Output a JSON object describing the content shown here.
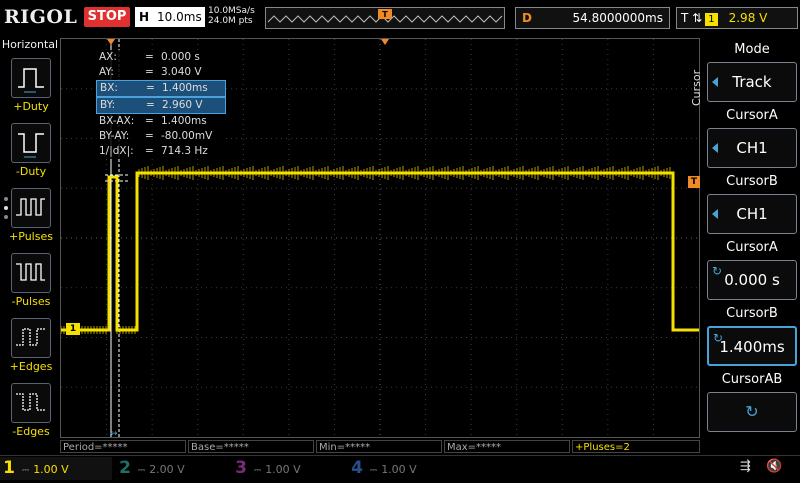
{
  "topbar": {
    "brand": "RIGOL",
    "run_state": "STOP",
    "timebase_label": "H",
    "timebase_value": "10.0ms",
    "sample_rate": "10.0MSa/s",
    "memory_depth": "24.0M pts",
    "delay_label": "D",
    "delay_value": "54.8000000ms",
    "trigger_type": "T",
    "trigger_source": "1",
    "trigger_level": "2.98 V"
  },
  "left_panel": {
    "title": "Horizontal",
    "items": [
      {
        "label": "+Duty",
        "icon": "positive-duty-icon"
      },
      {
        "label": "-Duty",
        "icon": "negative-duty-icon"
      },
      {
        "label": "+Pulses",
        "icon": "positive-pulses-icon"
      },
      {
        "label": "-Pulses",
        "icon": "negative-pulses-icon"
      },
      {
        "label": "+Edges",
        "icon": "rising-edges-icon"
      },
      {
        "label": "-Edges",
        "icon": "falling-edges-icon"
      }
    ]
  },
  "cursor_readout": [
    {
      "key": "AX:",
      "value": "0.000 s",
      "selected": false
    },
    {
      "key": "AY:",
      "value": "3.040 V",
      "selected": false
    },
    {
      "key": "BX:",
      "value": "1.400ms",
      "selected": true
    },
    {
      "key": "BY:",
      "value": "2.960 V",
      "selected": true
    },
    {
      "key": "BX-AX:",
      "value": "1.400ms",
      "selected": false
    },
    {
      "key": "BY-AY:",
      "value": "-80.00mV",
      "selected": false
    },
    {
      "key": "1/|dX|:",
      "value": "714.3 Hz",
      "selected": false
    }
  ],
  "measure_bar": {
    "period": "Period=*****",
    "base": "Base=*****",
    "min": "Min=*****",
    "max": "Max=*****",
    "pulses": "+Pluses=2"
  },
  "channels": [
    {
      "num": "1",
      "scale": "1.00 V",
      "color": "#f5e000",
      "active": true
    },
    {
      "num": "2",
      "scale": "2.00 V",
      "color": "#22c7b8",
      "active": false
    },
    {
      "num": "3",
      "scale": "1.00 V",
      "color": "#d040d0",
      "active": false
    },
    {
      "num": "4",
      "scale": "1.00 V",
      "color": "#3a7ee0",
      "active": false
    }
  ],
  "right_menu": {
    "side_label": "Cursor",
    "mode_label": "Mode",
    "mode_value": "Track",
    "cursorA_source_label": "CursorA",
    "cursorA_source_value": "CH1",
    "cursorB_source_label": "CursorB",
    "cursorB_source_value": "CH1",
    "cursorA_pos_label": "CursorA",
    "cursorA_pos_value": "0.000 s",
    "cursorB_pos_label": "CursorB",
    "cursorB_pos_value": "1.400ms",
    "cursorAB_label": "CursorAB"
  },
  "markers": {
    "channel1_marker": "1",
    "trigger_level_marker": "T",
    "cursor_marker_a": "A",
    "cursor_marker_b": "B"
  },
  "colors": {
    "ch1": "#f5e000",
    "trigger": "#f08a24",
    "accent": "#4aa3d8"
  }
}
